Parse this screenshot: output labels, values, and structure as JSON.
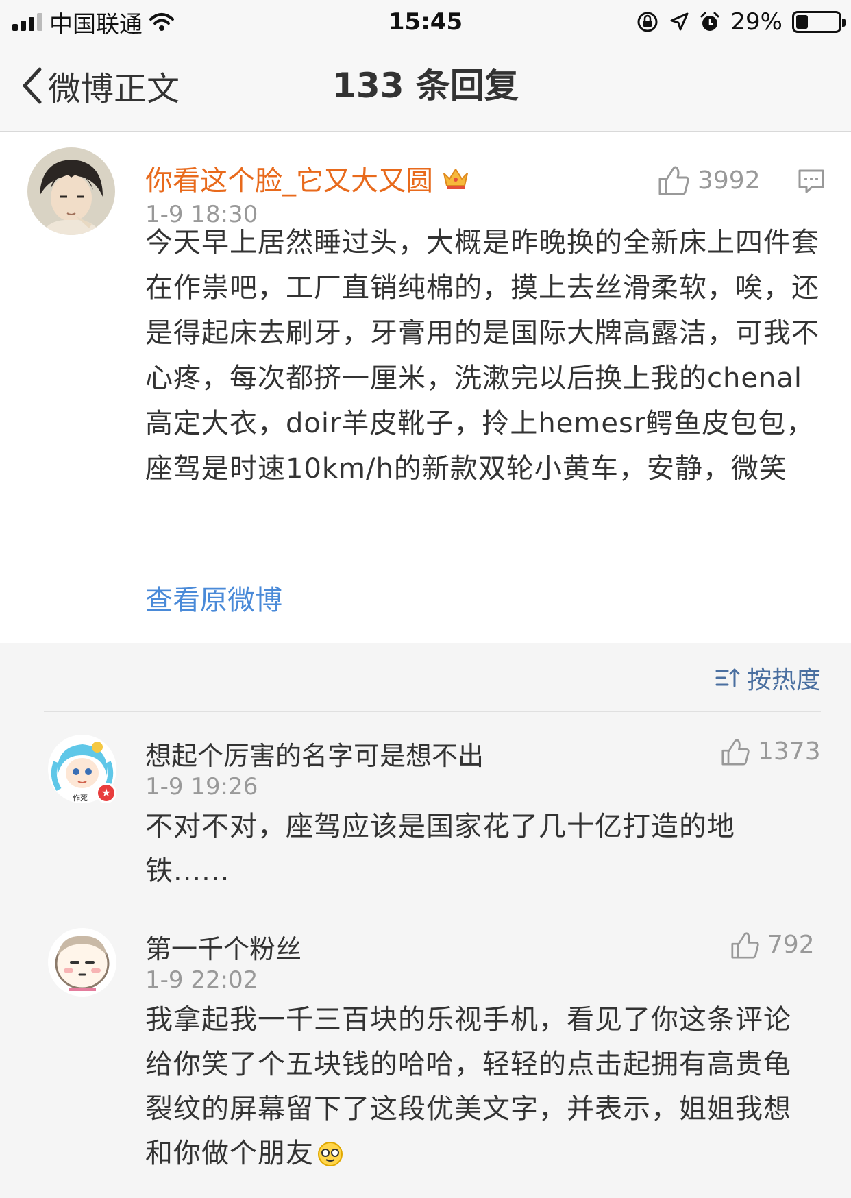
{
  "status_bar": {
    "carrier": "中国联通",
    "time": "15:45",
    "battery_percent": "29%",
    "battery_level": 0.29
  },
  "nav": {
    "back_label": "微博正文",
    "title": "133 条回复"
  },
  "post": {
    "author": "你看这个脸_它又大又圆",
    "time": "1-9 18:30",
    "likes": "3992",
    "body": "今天早上居然睡过头，大概是昨晚换的全新床上四件套在作祟吧，工厂直销纯棉的，摸上去丝滑柔软，唉，还是得起床去刷牙，牙膏用的是国际大牌高露洁，可我不心疼，每次都挤一厘米，洗漱完以后换上我的chenal高定大衣，doir羊皮靴子，拎上hemesr鳄鱼皮包包，座驾是时速10km/h的新款双轮小黄车，安静，微笑",
    "view_original": "查看原微博"
  },
  "sort": {
    "label": "按热度"
  },
  "replies": [
    {
      "author": "想起个厉害的名字可是想不出",
      "time": "1-9 19:26",
      "likes": "1373",
      "body": "不对不对，座驾应该是国家花了几十亿打造的地铁......"
    },
    {
      "author": "第一千个粉丝",
      "time": "1-9 22:02",
      "likes": "792",
      "body": "我拿起我一千三百块的乐视手机，看见了你这条评论给你笑了个五块钱的哈哈，轻轻的点击起拥有高贵龟裂纹的屏幕留下了这段优美文字，并表示，姐姐我想和你做个朋友"
    }
  ],
  "icons": {
    "signal": "signal-bars-icon",
    "wifi": "wifi-icon",
    "lock_rotation": "rotation-lock-icon",
    "location": "location-arrow-icon",
    "alarm": "alarm-icon",
    "battery": "battery-icon",
    "back": "chevron-left-icon",
    "crown": "crown-badge-icon",
    "like": "thumbs-up-icon",
    "comment": "comment-icon",
    "sort": "sort-icon",
    "emoji": "emoji-icon"
  },
  "colors": {
    "author_highlight": "#e86a1c",
    "link": "#4a8ad8",
    "meta": "#999999"
  }
}
